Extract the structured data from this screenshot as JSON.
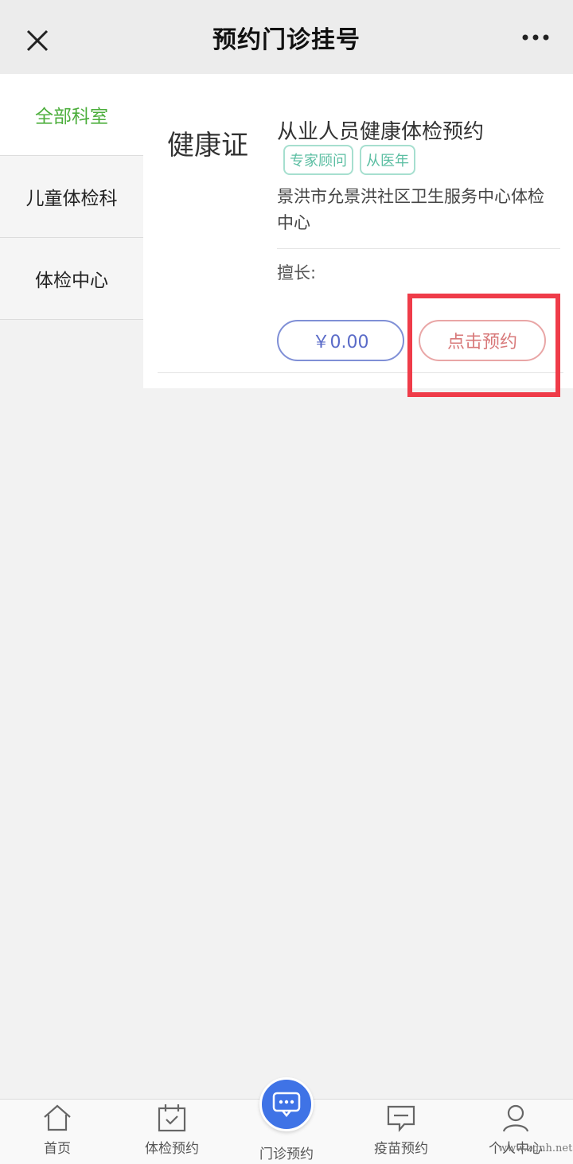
{
  "header": {
    "title": "预约门诊挂号"
  },
  "sidebar": {
    "items": [
      {
        "label": "全部科室",
        "active": true
      },
      {
        "label": "儿童体检科",
        "active": false
      },
      {
        "label": "体检中心",
        "active": false
      }
    ]
  },
  "card": {
    "category": "健康证",
    "name": "从业人员健康体检预约",
    "tags": [
      "专家顾问",
      "从医年"
    ],
    "org": "景洪市允景洪社区卫生服务中心体检中心",
    "skill_label": "擅长:",
    "price": "￥0.00",
    "book_label": "点击预约"
  },
  "tabbar": {
    "tabs": [
      {
        "label": "首页",
        "icon": "home-icon"
      },
      {
        "label": "体检预约",
        "icon": "calendar-check-icon"
      },
      {
        "label": "门诊预约",
        "icon": "chat-icon"
      },
      {
        "label": "疫苗预约",
        "icon": "message-icon"
      },
      {
        "label": "个人中心",
        "icon": "user-icon"
      }
    ]
  },
  "watermark": "www.zgnh.net",
  "colors": {
    "active_green": "#4cae3c",
    "primary_blue": "#3f73e6",
    "highlight_red": "#ef3c49"
  }
}
